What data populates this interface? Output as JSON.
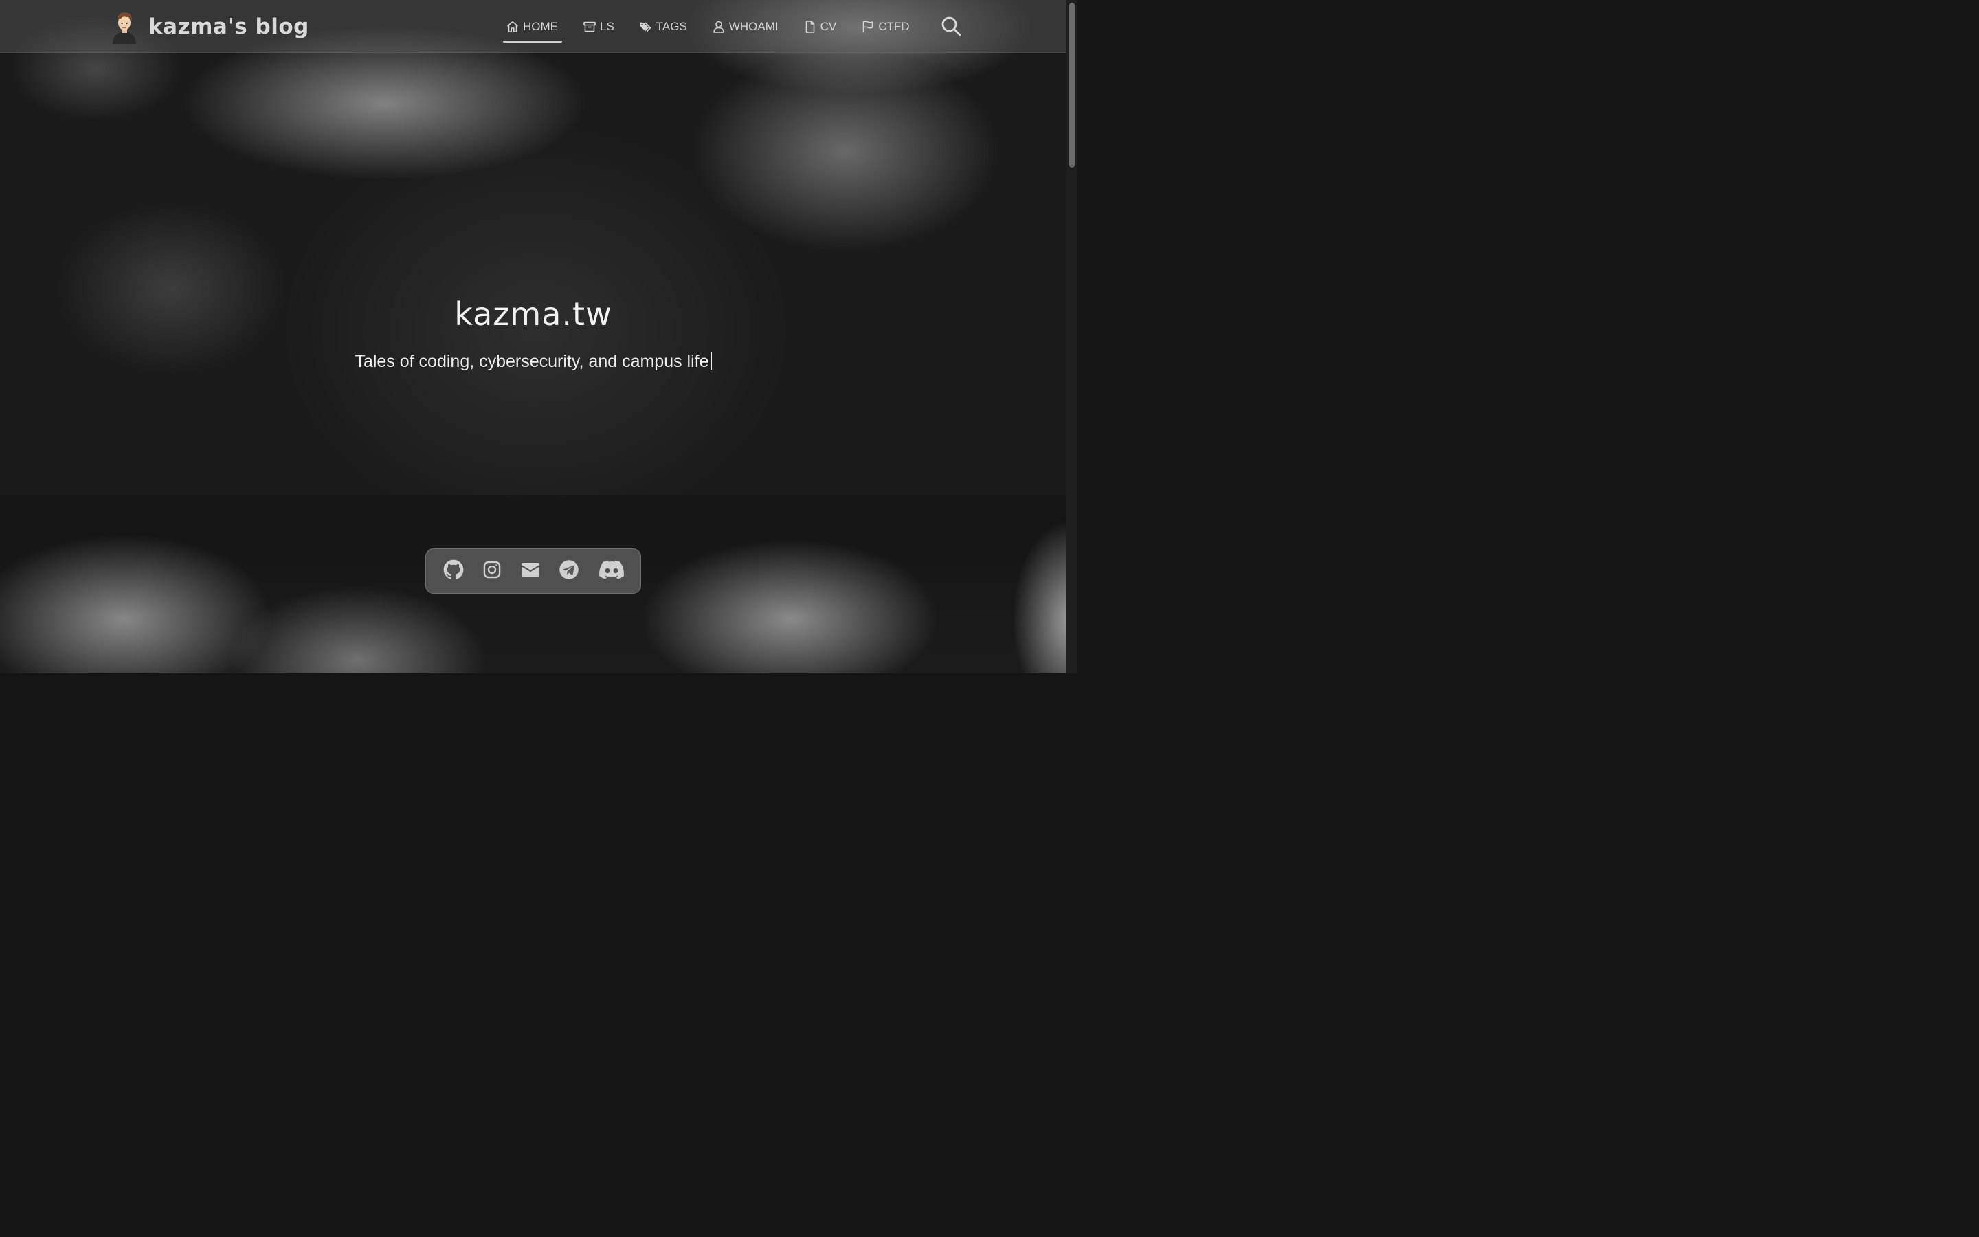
{
  "header": {
    "brand_title": "kazma's blog",
    "nav": [
      {
        "label": "HOME",
        "icon": "home-icon",
        "active": true
      },
      {
        "label": "LS",
        "icon": "archive-icon",
        "active": false
      },
      {
        "label": "TAGS",
        "icon": "tags-icon",
        "active": false
      },
      {
        "label": "WHOAMI",
        "icon": "user-icon",
        "active": false
      },
      {
        "label": "CV",
        "icon": "file-icon",
        "active": false
      },
      {
        "label": "CTFD",
        "icon": "flag-icon",
        "active": false
      }
    ],
    "search_icon": "search-icon"
  },
  "hero": {
    "title": "kazma.tw",
    "subtitle": "Tales of coding, cybersecurity, and campus life"
  },
  "social": [
    {
      "icon": "github-icon"
    },
    {
      "icon": "instagram-icon"
    },
    {
      "icon": "email-icon"
    },
    {
      "icon": "telegram-icon"
    },
    {
      "icon": "discord-icon"
    }
  ],
  "colors": {
    "nav_text": "#d4d4d4",
    "hero_text": "#f2f2f2",
    "social_bg": "#5a5a5a",
    "icon_color": "#d0d0d0"
  }
}
